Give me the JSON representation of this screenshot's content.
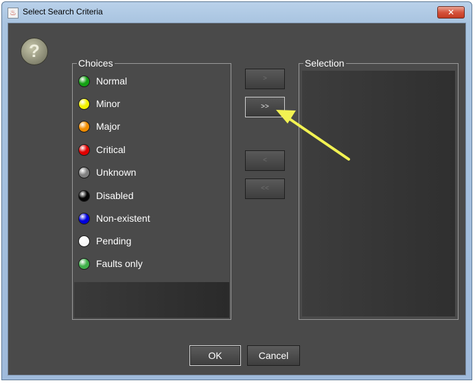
{
  "window": {
    "title": "Select Search Criteria",
    "close_label": "✕"
  },
  "help": {
    "glyph": "?"
  },
  "choices": {
    "legend": "Choices",
    "items": [
      {
        "label": "Normal",
        "color": "#14a014",
        "icon": "green-status-dot-icon"
      },
      {
        "label": "Minor",
        "color": "#f2f200",
        "icon": "yellow-status-dot-icon"
      },
      {
        "label": "Major",
        "color": "#f08c00",
        "icon": "orange-status-dot-icon"
      },
      {
        "label": "Critical",
        "color": "#e00000",
        "icon": "red-status-dot-icon"
      },
      {
        "label": "Unknown",
        "color": "#808080",
        "icon": "gray-status-dot-icon"
      },
      {
        "label": "Disabled",
        "color": "#050505",
        "icon": "black-status-dot-icon"
      },
      {
        "label": "Non-existent",
        "color": "#0000dd",
        "icon": "blue-status-dot-icon"
      },
      {
        "label": "Pending",
        "color": "#f8f8f8",
        "icon": "white-status-dot-icon"
      },
      {
        "label": "Faults only",
        "color": "#3fb04a",
        "icon": "light-green-status-dot-icon"
      }
    ]
  },
  "selection": {
    "legend": "Selection",
    "items": []
  },
  "transfer": {
    "add_label": ">",
    "add_all_label": ">>",
    "remove_label": "<",
    "remove_all_label": "<<"
  },
  "buttons": {
    "ok_label": "OK",
    "cancel_label": "Cancel"
  },
  "annotation": {
    "arrow_color": "#f2f252"
  }
}
